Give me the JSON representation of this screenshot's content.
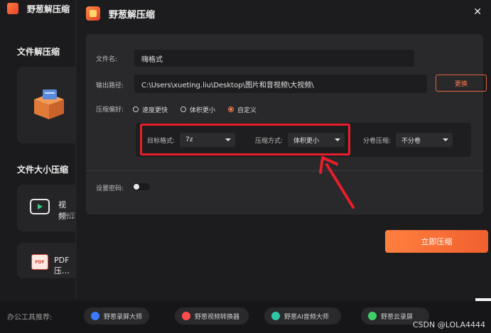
{
  "background": {
    "app_name": "野葱解压缩",
    "sections": [
      "文件解压缩",
      "文件大小压缩"
    ],
    "tools": [
      {
        "title": "视频…",
        "subtitle": "多种压…"
      },
      {
        "title": "PDF压…"
      }
    ],
    "pdf_badge": "PDF"
  },
  "dialog": {
    "title": "野葱解压缩",
    "filename_label": "文件名:",
    "filename_value": "嗨格式",
    "output_label": "输出路径:",
    "output_value": "C:\\Users\\xueting.liu\\Desktop\\图片和音视频\\大视频\\",
    "change_label": "更换",
    "pref_label": "压缩偏好:",
    "pref_options": [
      {
        "label": "速度更快",
        "selected": false
      },
      {
        "label": "体积更小",
        "selected": false
      },
      {
        "label": "自定义",
        "selected": true
      }
    ],
    "target_format_label": "目标格式:",
    "target_format_value": "7z",
    "method_label": "压缩方式:",
    "method_value": "体积更小",
    "split_label": "分卷压缩:",
    "split_value": "不分卷",
    "password_label": "设置密码:",
    "password_enabled": false,
    "compress_button": "立即压缩"
  },
  "bottom_bar": {
    "label": "办公工具推荐:",
    "items": [
      {
        "label": "野葱录屏大师",
        "color": "#3a7bff"
      },
      {
        "label": "野葱视频转换器",
        "color": "#ff4b4b"
      },
      {
        "label": "野葱AI音频大师",
        "color": "#2ec4a6"
      },
      {
        "label": "野葱云录屏",
        "color": "#3ecf6a"
      }
    ]
  },
  "watermark": "CSDN @LOLA4444",
  "colors": {
    "accent": "#ff7d4a",
    "highlight": "#e81e2a"
  }
}
